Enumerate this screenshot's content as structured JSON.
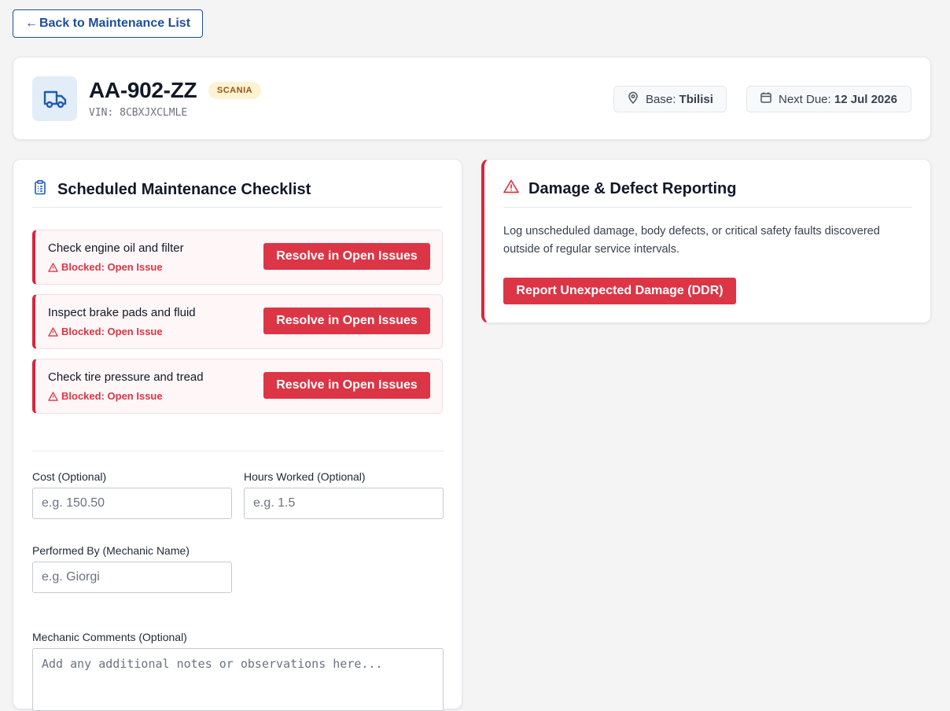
{
  "nav": {
    "back_label": "Back to Maintenance List"
  },
  "vehicle": {
    "plate": "AA-902-ZZ",
    "brand": "SCANIA",
    "vin_label": "VIN:",
    "vin": "8CBXJXCLMLE",
    "base_label": "Base:",
    "base": "Tbilisi",
    "next_due_label": "Next Due:",
    "next_due": "12 Jul 2026"
  },
  "checklist": {
    "title": "Scheduled Maintenance Checklist",
    "tasks": [
      {
        "name": "Check engine oil and filter",
        "status": "Blocked: Open Issue",
        "action": "Resolve in Open Issues"
      },
      {
        "name": "Inspect brake pads and fluid",
        "status": "Blocked: Open Issue",
        "action": "Resolve in Open Issues"
      },
      {
        "name": "Check tire pressure and tread",
        "status": "Blocked: Open Issue",
        "action": "Resolve in Open Issues"
      }
    ]
  },
  "form": {
    "cost_label": "Cost (Optional)",
    "cost_placeholder": "e.g. 150.50",
    "hours_label": "Hours Worked (Optional)",
    "hours_placeholder": "e.g. 1.5",
    "performed_by_label": "Performed By (Mechanic Name)",
    "performed_by_placeholder": "e.g. Giorgi",
    "comments_label": "Mechanic Comments (Optional)",
    "comments_placeholder": "Add any additional notes or observations here..."
  },
  "damage": {
    "title": "Damage & Defect Reporting",
    "description": "Log unscheduled damage, body defects, or critical safety faults discovered outside of regular service intervals.",
    "button_label": "Report Unexpected Damage (DDR)"
  },
  "colors": {
    "accent_blue": "#1e4e9a",
    "danger_red": "#dc3545",
    "badge_bg": "#fdf3d3",
    "badge_text": "#92580f"
  }
}
